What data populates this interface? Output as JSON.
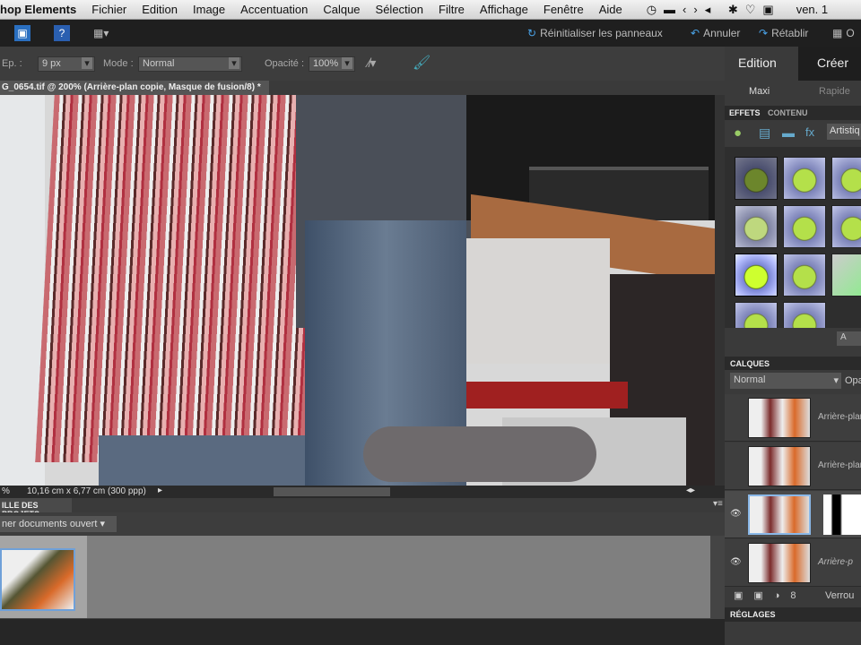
{
  "menubar": {
    "app": "hop Elements",
    "items": [
      "Fichier",
      "Edition",
      "Image",
      "Accentuation",
      "Calque",
      "Sélection",
      "Filtre",
      "Affichage",
      "Fenêtre",
      "Aide"
    ],
    "clock": "ven. 1"
  },
  "toolbar": {
    "reset": "Réinitialiser les panneaux",
    "undo": "Annuler",
    "redo": "Rétablir",
    "organizer": "O"
  },
  "options": {
    "size_label": "Ep. :",
    "size_value": "9 px",
    "mode_label": "Mode :",
    "mode_value": "Normal",
    "opacity_label": "Opacité :",
    "opacity_value": "100%"
  },
  "document": {
    "tab": "G_0654.tif @ 200% (Arrière-plan copie, Masque de fusion/8) *",
    "zoom": "%",
    "dimensions": "10,16 cm x 6,77 cm (300 ppp)"
  },
  "bin": {
    "title": "ILLE DES PROJETS",
    "dropdown": "ner documents ouvert"
  },
  "right": {
    "tabs": [
      "Edition",
      "Créer"
    ],
    "subtabs": [
      "Maxi",
      "Rapide"
    ],
    "panel_tabs": [
      "EFFETS",
      "CONTENU"
    ],
    "category": "Artistiq",
    "apply": "A",
    "layers_title": "CALQUES",
    "blend": "Normal",
    "opacity_short": "Opa",
    "layers": [
      {
        "name": "Arrière-plan"
      },
      {
        "name": "Arrière-plan"
      },
      {
        "name": ""
      },
      {
        "name": "Arrière-p"
      }
    ],
    "lock": "Verrou",
    "adjust_title": "RÉGLAGES"
  }
}
